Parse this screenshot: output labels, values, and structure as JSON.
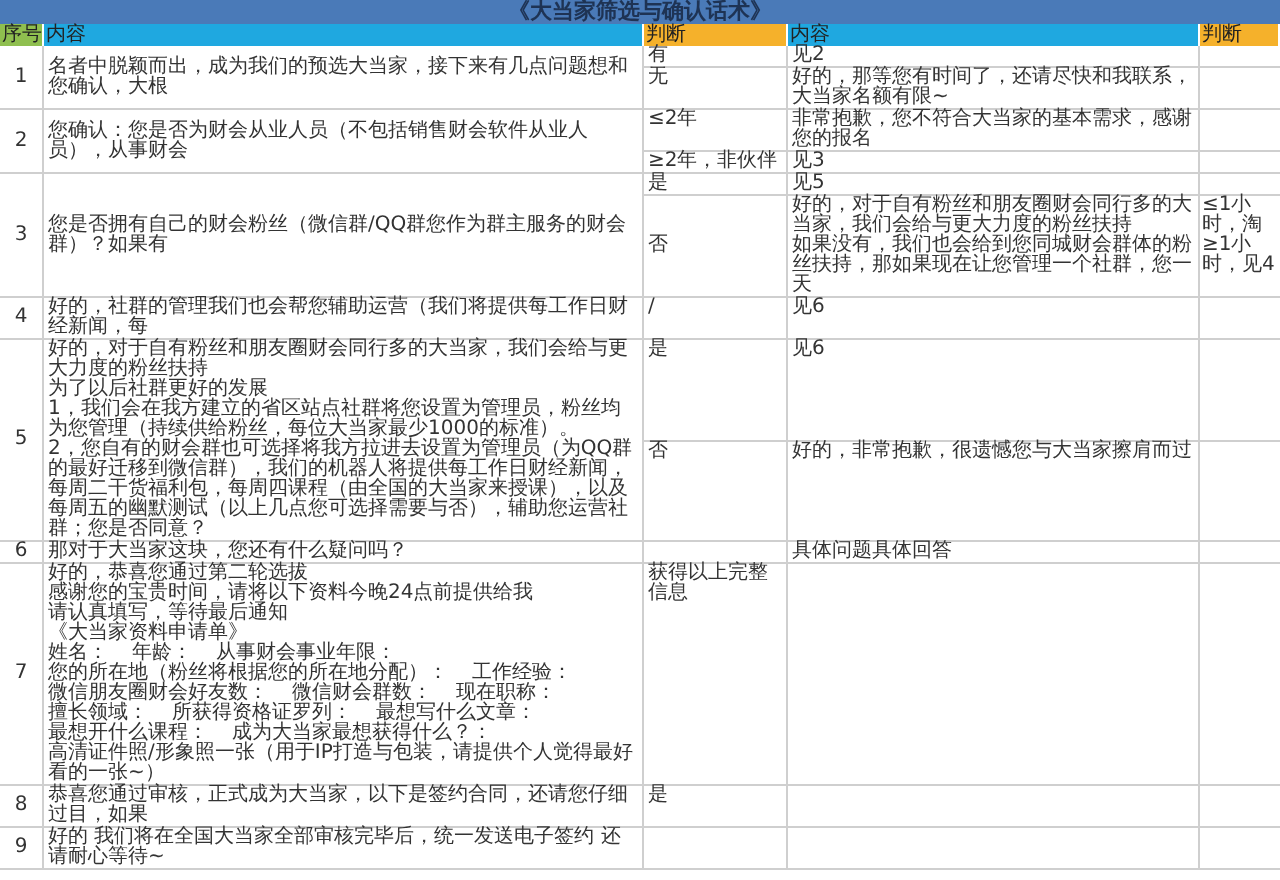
{
  "title": "《大当家筛选与确认话术》",
  "columns": [
    {
      "label": "序号",
      "kind": "index"
    },
    {
      "label": "内容",
      "kind": "content"
    },
    {
      "label": "判断",
      "kind": "judge"
    },
    {
      "label": "内容",
      "kind": "content"
    },
    {
      "label": "判断",
      "kind": "judge"
    }
  ],
  "rows": [
    {
      "no": "1",
      "content": [
        "名者中脱颖而出，成为我们的预选大当家，接下来有几点问题想和您确认，大根"
      ],
      "options": [
        {
          "judge": "有",
          "replies": [
            {
              "text": "见2"
            }
          ]
        },
        {
          "judge": "无",
          "replies": [
            {
              "text": "好的，那等您有时间了，还请尽快和我联系，大当家名额有限~"
            }
          ]
        }
      ]
    },
    {
      "no": "2",
      "content": [
        "您确认：您是否为财会从业人员（不包括销售财会软件从业人员），从事财会"
      ],
      "options": [
        {
          "judge": "≤2年",
          "replies": [
            {
              "text": "非常抱歉，您不符合大当家的基本需求，感谢您的报名"
            }
          ]
        },
        {
          "judge": "≥2年，非伙伴",
          "replies": [
            {
              "text": "见3"
            }
          ]
        }
      ]
    },
    {
      "no": "3",
      "content": [
        "您是否拥有自己的财会粉丝（微信群/QQ群您作为群主服务的财会群）？如果有"
      ],
      "options": [
        {
          "judge": "是",
          "replies": [
            {
              "text": "见5"
            }
          ]
        },
        {
          "judge": "否",
          "replies": [
            {
              "text": "好的，对于自有粉丝和朋友圈财会同行多的大当家，我们会给与更大力度的粉丝扶持",
              "note": "≤1小时，淘"
            },
            {
              "text": "如果没有，我们也会给到您同城财会群体的粉丝扶持，那如果现在让您管理一个社群，您一天",
              "note": "≥1小时，见4"
            }
          ]
        }
      ]
    },
    {
      "no": "4",
      "content": [
        "好的，社群的管理我们也会帮您辅助运营（我们将提供每工作日财经新闻，每"
      ],
      "options": [
        {
          "judge": "/",
          "replies": [
            {
              "text": "见6"
            }
          ]
        }
      ]
    },
    {
      "no": "5",
      "content": [
        "好的，对于自有粉丝和朋友圈财会同行多的大当家，我们会给与更大力度的粉丝扶持",
        "为了以后社群更好的发展",
        "1，我们会在我方建立的省区站点社群将您设置为管理员，粉丝均为您管理（持续供给粉丝，每位大当家最少1000的标准）。",
        "2，您自有的财会群也可选择将我方拉进去设置为管理员（为QQ群的最好迁移到微信群），我们的机器人将提供每工作日财经新闻，每周二干货福利包，每周四课程（由全国的大当家来授课），以及每周五的幽默测试（以上几点您可选择需要与否），辅助您运营社群；您是否同意？"
      ],
      "options": [
        {
          "judge": "是",
          "replies": [
            {
              "text": "见6"
            }
          ]
        },
        {
          "judge": "否",
          "replies": [
            {
              "text": "好的，非常抱歉，很遗憾您与大当家擦肩而过"
            }
          ]
        }
      ]
    },
    {
      "no": "6",
      "content": [
        "那对于大当家这块，您还有什么疑问吗？"
      ],
      "options": [
        {
          "replies": [
            {
              "text": "具体问题具体回答"
            }
          ]
        }
      ]
    },
    {
      "no": "7",
      "content": [
        "好的，恭喜您通过第二轮选拔",
        "感谢您的宝贵时间，请将以下资料今晚24点前提供给我",
        "请认真填写，等待最后通知",
        "《大当家资料申请单》"
      ],
      "form_fields": [
        "姓名：",
        "年龄：",
        "从事财会事业年限：",
        "您的所在地（粉丝将根据您的所在地分配）：",
        "工作经验：",
        "微信朋友圈财会好友数：",
        "微信财会群数：",
        "现在职称：",
        "擅长领域：",
        "所获得资格证罗列：",
        "最想写什么文章：",
        "最想开什么课程：",
        "成为大当家最想获得什么？：",
        "高清证件照/形象照一张（用于IP打造与包装，请提供个人觉得最好看的一张~）"
      ],
      "options": [
        {
          "judge": "获得以上完整信息"
        }
      ]
    },
    {
      "no": "8",
      "content": [
        "恭喜您通过审核，正式成为大当家，以下是签约合同，还请您仔细过目，如果"
      ],
      "options": [
        {
          "judge": "是"
        }
      ]
    },
    {
      "no": "9",
      "content": [
        "好的 我们将在全国大当家全部审核完毕后，统一发送电子签约 还请耐心等待~"
      ]
    }
  ]
}
